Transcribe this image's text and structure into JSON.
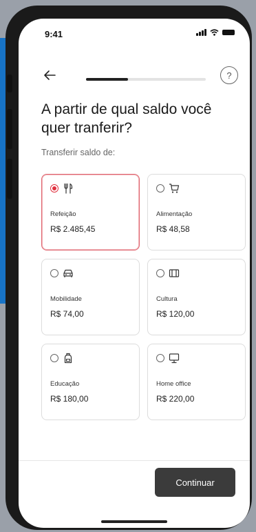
{
  "status_bar": {
    "time": "9:41"
  },
  "progress": {
    "fraction": 0.35
  },
  "header": {
    "help_icon": "?"
  },
  "page": {
    "title": "A partir de qual saldo você quer tranferir?",
    "subtitle": "Transferir saldo de:"
  },
  "options": [
    {
      "label": "Refeição",
      "value": "R$ 2.485,45",
      "icon": "fork-knife-icon",
      "selected": true
    },
    {
      "label": "Alimentação",
      "value": "R$ 48,58",
      "icon": "cart-icon",
      "selected": false
    },
    {
      "label": "Mobilidade",
      "value": "R$ 74,00",
      "icon": "car-icon",
      "selected": false
    },
    {
      "label": "Cultura",
      "value": "R$ 120,00",
      "icon": "ticket-icon",
      "selected": false
    },
    {
      "label": "Educação",
      "value": "R$ 180,00",
      "icon": "backpack-icon",
      "selected": false
    },
    {
      "label": "Home office",
      "value": "R$ 220,00",
      "icon": "monitor-icon",
      "selected": false
    }
  ],
  "footer": {
    "continue_label": "Continuar"
  },
  "colors": {
    "accent": "#e0313f",
    "button": "#3b3b3b"
  }
}
